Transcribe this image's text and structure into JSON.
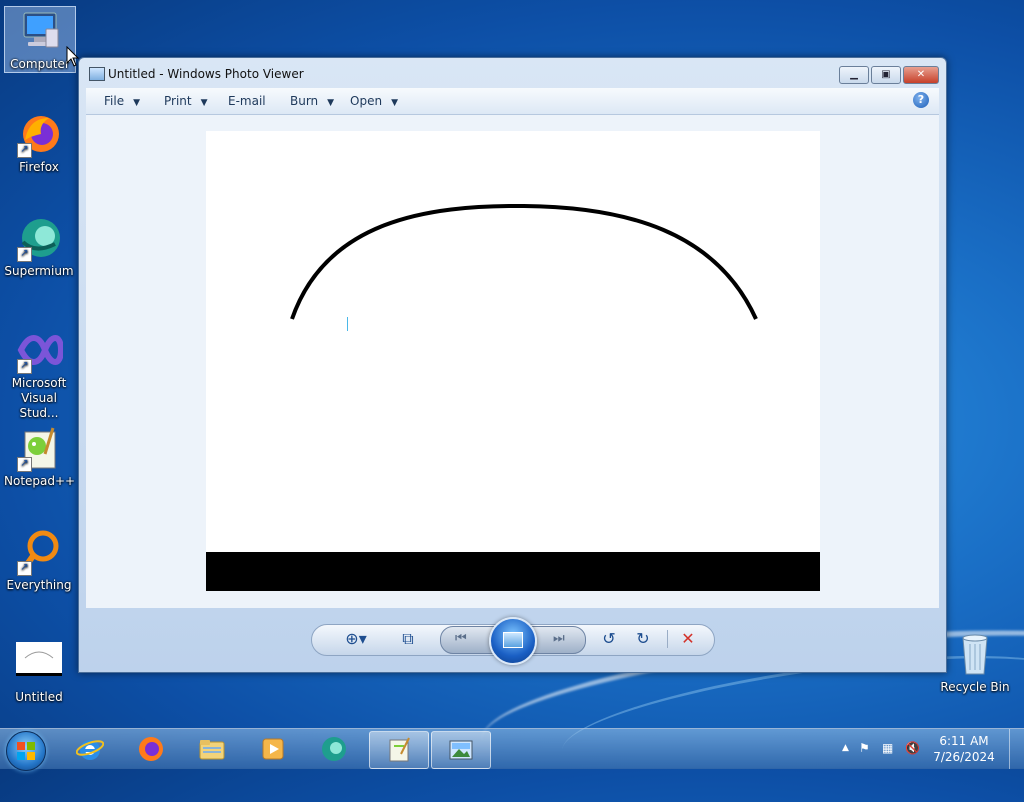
{
  "desktop": {
    "icons": [
      {
        "label": "Computer"
      },
      {
        "label": "Firefox"
      },
      {
        "label": "Supermium"
      },
      {
        "label": "Microsoft Visual Stud..."
      },
      {
        "label": "Notepad++"
      },
      {
        "label": "Everything"
      },
      {
        "label": "Untitled"
      },
      {
        "label": "Recycle Bin"
      }
    ]
  },
  "window": {
    "title": "Untitled - Windows Photo Viewer",
    "buttons": {
      "minimize": "▁",
      "maximize": "▣",
      "close": "✕"
    },
    "menu": {
      "file": "File",
      "print": "Print",
      "email": "E-mail",
      "burn": "Burn",
      "open": "Open",
      "dropdown_arrow": "▼",
      "help": "?"
    },
    "controls": {
      "zoom": "⊕▾",
      "actual_size": "⧉",
      "previous": "⏮",
      "next": "⏭",
      "rotate_ccw": "↺",
      "rotate_cw": "↻",
      "delete": "✕"
    }
  },
  "taskbar": {
    "clock_time": "6:11 AM",
    "clock_date": "7/26/2024",
    "tray": {
      "show_hidden": "▲",
      "flag": "⚑",
      "network": "▦",
      "volume": "🔇"
    }
  },
  "colors": {
    "accent": "#1d4d8f",
    "delete_red": "#d3322a",
    "desktop_blue": "#1a6fc6"
  }
}
